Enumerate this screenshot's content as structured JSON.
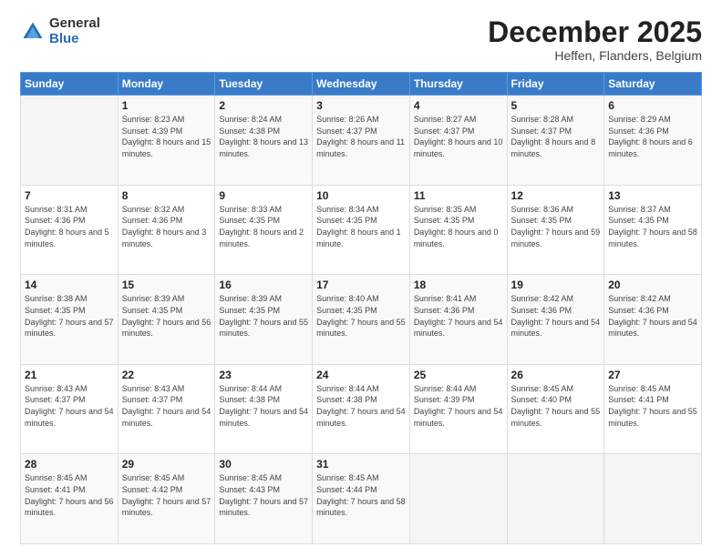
{
  "logo": {
    "general": "General",
    "blue": "Blue"
  },
  "header": {
    "month": "December 2025",
    "location": "Heffen, Flanders, Belgium"
  },
  "days_of_week": [
    "Sunday",
    "Monday",
    "Tuesday",
    "Wednesday",
    "Thursday",
    "Friday",
    "Saturday"
  ],
  "weeks": [
    [
      {
        "day": "",
        "sunrise": "",
        "sunset": "",
        "daylight": "",
        "empty": true
      },
      {
        "day": "1",
        "sunrise": "Sunrise: 8:23 AM",
        "sunset": "Sunset: 4:39 PM",
        "daylight": "Daylight: 8 hours and 15 minutes."
      },
      {
        "day": "2",
        "sunrise": "Sunrise: 8:24 AM",
        "sunset": "Sunset: 4:38 PM",
        "daylight": "Daylight: 8 hours and 13 minutes."
      },
      {
        "day": "3",
        "sunrise": "Sunrise: 8:26 AM",
        "sunset": "Sunset: 4:37 PM",
        "daylight": "Daylight: 8 hours and 11 minutes."
      },
      {
        "day": "4",
        "sunrise": "Sunrise: 8:27 AM",
        "sunset": "Sunset: 4:37 PM",
        "daylight": "Daylight: 8 hours and 10 minutes."
      },
      {
        "day": "5",
        "sunrise": "Sunrise: 8:28 AM",
        "sunset": "Sunset: 4:37 PM",
        "daylight": "Daylight: 8 hours and 8 minutes."
      },
      {
        "day": "6",
        "sunrise": "Sunrise: 8:29 AM",
        "sunset": "Sunset: 4:36 PM",
        "daylight": "Daylight: 8 hours and 6 minutes."
      }
    ],
    [
      {
        "day": "7",
        "sunrise": "Sunrise: 8:31 AM",
        "sunset": "Sunset: 4:36 PM",
        "daylight": "Daylight: 8 hours and 5 minutes."
      },
      {
        "day": "8",
        "sunrise": "Sunrise: 8:32 AM",
        "sunset": "Sunset: 4:36 PM",
        "daylight": "Daylight: 8 hours and 3 minutes."
      },
      {
        "day": "9",
        "sunrise": "Sunrise: 8:33 AM",
        "sunset": "Sunset: 4:35 PM",
        "daylight": "Daylight: 8 hours and 2 minutes."
      },
      {
        "day": "10",
        "sunrise": "Sunrise: 8:34 AM",
        "sunset": "Sunset: 4:35 PM",
        "daylight": "Daylight: 8 hours and 1 minute."
      },
      {
        "day": "11",
        "sunrise": "Sunrise: 8:35 AM",
        "sunset": "Sunset: 4:35 PM",
        "daylight": "Daylight: 8 hours and 0 minutes."
      },
      {
        "day": "12",
        "sunrise": "Sunrise: 8:36 AM",
        "sunset": "Sunset: 4:35 PM",
        "daylight": "Daylight: 7 hours and 59 minutes."
      },
      {
        "day": "13",
        "sunrise": "Sunrise: 8:37 AM",
        "sunset": "Sunset: 4:35 PM",
        "daylight": "Daylight: 7 hours and 58 minutes."
      }
    ],
    [
      {
        "day": "14",
        "sunrise": "Sunrise: 8:38 AM",
        "sunset": "Sunset: 4:35 PM",
        "daylight": "Daylight: 7 hours and 57 minutes."
      },
      {
        "day": "15",
        "sunrise": "Sunrise: 8:39 AM",
        "sunset": "Sunset: 4:35 PM",
        "daylight": "Daylight: 7 hours and 56 minutes."
      },
      {
        "day": "16",
        "sunrise": "Sunrise: 8:39 AM",
        "sunset": "Sunset: 4:35 PM",
        "daylight": "Daylight: 7 hours and 55 minutes."
      },
      {
        "day": "17",
        "sunrise": "Sunrise: 8:40 AM",
        "sunset": "Sunset: 4:35 PM",
        "daylight": "Daylight: 7 hours and 55 minutes."
      },
      {
        "day": "18",
        "sunrise": "Sunrise: 8:41 AM",
        "sunset": "Sunset: 4:36 PM",
        "daylight": "Daylight: 7 hours and 54 minutes."
      },
      {
        "day": "19",
        "sunrise": "Sunrise: 8:42 AM",
        "sunset": "Sunset: 4:36 PM",
        "daylight": "Daylight: 7 hours and 54 minutes."
      },
      {
        "day": "20",
        "sunrise": "Sunrise: 8:42 AM",
        "sunset": "Sunset: 4:36 PM",
        "daylight": "Daylight: 7 hours and 54 minutes."
      }
    ],
    [
      {
        "day": "21",
        "sunrise": "Sunrise: 8:43 AM",
        "sunset": "Sunset: 4:37 PM",
        "daylight": "Daylight: 7 hours and 54 minutes."
      },
      {
        "day": "22",
        "sunrise": "Sunrise: 8:43 AM",
        "sunset": "Sunset: 4:37 PM",
        "daylight": "Daylight: 7 hours and 54 minutes."
      },
      {
        "day": "23",
        "sunrise": "Sunrise: 8:44 AM",
        "sunset": "Sunset: 4:38 PM",
        "daylight": "Daylight: 7 hours and 54 minutes."
      },
      {
        "day": "24",
        "sunrise": "Sunrise: 8:44 AM",
        "sunset": "Sunset: 4:38 PM",
        "daylight": "Daylight: 7 hours and 54 minutes."
      },
      {
        "day": "25",
        "sunrise": "Sunrise: 8:44 AM",
        "sunset": "Sunset: 4:39 PM",
        "daylight": "Daylight: 7 hours and 54 minutes."
      },
      {
        "day": "26",
        "sunrise": "Sunrise: 8:45 AM",
        "sunset": "Sunset: 4:40 PM",
        "daylight": "Daylight: 7 hours and 55 minutes."
      },
      {
        "day": "27",
        "sunrise": "Sunrise: 8:45 AM",
        "sunset": "Sunset: 4:41 PM",
        "daylight": "Daylight: 7 hours and 55 minutes."
      }
    ],
    [
      {
        "day": "28",
        "sunrise": "Sunrise: 8:45 AM",
        "sunset": "Sunset: 4:41 PM",
        "daylight": "Daylight: 7 hours and 56 minutes."
      },
      {
        "day": "29",
        "sunrise": "Sunrise: 8:45 AM",
        "sunset": "Sunset: 4:42 PM",
        "daylight": "Daylight: 7 hours and 57 minutes."
      },
      {
        "day": "30",
        "sunrise": "Sunrise: 8:45 AM",
        "sunset": "Sunset: 4:43 PM",
        "daylight": "Daylight: 7 hours and 57 minutes."
      },
      {
        "day": "31",
        "sunrise": "Sunrise: 8:45 AM",
        "sunset": "Sunset: 4:44 PM",
        "daylight": "Daylight: 7 hours and 58 minutes."
      },
      {
        "day": "",
        "sunrise": "",
        "sunset": "",
        "daylight": "",
        "empty": true
      },
      {
        "day": "",
        "sunrise": "",
        "sunset": "",
        "daylight": "",
        "empty": true
      },
      {
        "day": "",
        "sunrise": "",
        "sunset": "",
        "daylight": "",
        "empty": true
      }
    ]
  ]
}
